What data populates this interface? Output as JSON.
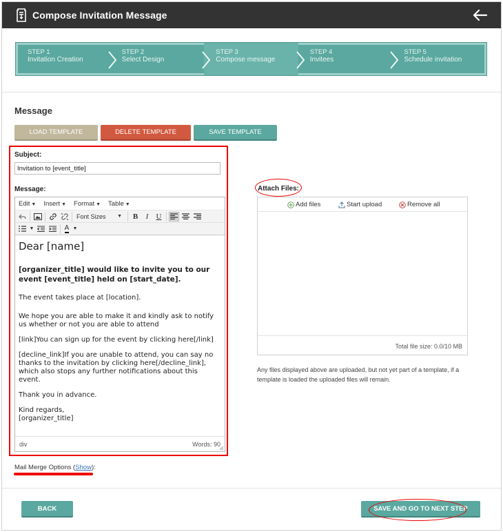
{
  "header": {
    "title": "Compose Invitation Message"
  },
  "steps": [
    {
      "num": "STEP 1",
      "name": "Invitation Creation",
      "active": false
    },
    {
      "num": "STEP 2",
      "name": "Select Design",
      "active": false
    },
    {
      "num": "STEP 3",
      "name": "Compose message",
      "active": true
    },
    {
      "num": "STEP 4",
      "name": "Invitees",
      "active": false
    },
    {
      "num": "STEP 5",
      "name": "Schedule invitation",
      "active": false
    }
  ],
  "message": {
    "section_title": "Message",
    "load_template": "LOAD TEMPLATE",
    "delete_template": "DELETE TEMPLATE",
    "save_template": "SAVE TEMPLATE",
    "subject_label": "Subject:",
    "subject_value": "Invitation to [event_title]",
    "message_label": "Message:"
  },
  "editor": {
    "menus": [
      "Edit",
      "Insert",
      "Format",
      "Table"
    ],
    "font_sizes_label": "Font Sizes",
    "bold": "B",
    "italic": "I",
    "underline": "U",
    "color_label": "A",
    "greeting": "Dear [name]",
    "intro": "[organizer_title] would like to invite you to our event [event_title] held on [start_date].",
    "p1": "The event takes place at [location].",
    "p2": "We hope you are able to make it and kindly ask to notify us whether or not you are able to attend",
    "p3": "[link]You can sign up for the event by clicking here[/link]",
    "p4": "[decline_link]If you are unable to attend, you can say no thanks to the invitation by clicking here[/decline_link], which also stops any further notifications about this event.",
    "p5": "Thank you in advance.",
    "p6_line1": "Kind regards,",
    "p6_line2": "[organizer_title]",
    "status_path": "div",
    "word_count": "Words: 90"
  },
  "merge": {
    "prefix": "Mail Merge Options (",
    "show": "Show",
    "suffix": "):"
  },
  "attach": {
    "label": "Attach Files:",
    "add_files": "Add files",
    "start_upload": "Start upload",
    "remove_all": "Remove all",
    "total_size": "Total file size: 0.0/10 MB",
    "note": "Any files displayed above are uploaded, but not yet part of a template, if a template is loaded the uploaded files will remain."
  },
  "footer": {
    "back": "BACK",
    "next": "SAVE AND GO TO NEXT STEP"
  },
  "colors": {
    "header_bg": "#333333",
    "teal": "#5aa89f",
    "tan": "#c0b79d",
    "red": "#d1593f",
    "highlight": "#ee0000"
  }
}
